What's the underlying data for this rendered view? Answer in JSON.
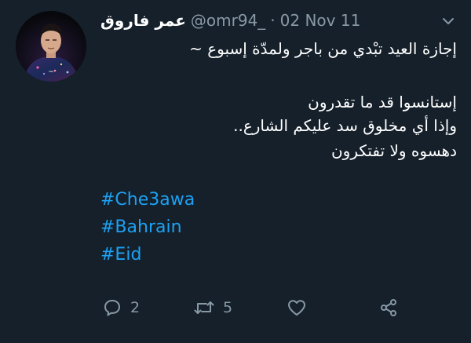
{
  "tweet": {
    "author_name": "عمر فاروق",
    "handle": "@omr94_",
    "separator": "·",
    "date": "02 Nov 11",
    "lines": [
      "إجازة العيد تبْدي من باجر ولمدّة إسبوع ~",
      "إستانسوا قد ما تقدرون",
      "وإذا أي مخلوق سد عليكم الشارع..",
      "دهسوه ولا تفتكرون"
    ],
    "hashtags": [
      "#Che3awa",
      "#Bahrain",
      "#Eid"
    ],
    "actions": {
      "reply_count": "2",
      "retweet_count": "5"
    },
    "icons": {
      "reply": "reply-icon",
      "retweet": "retweet-icon",
      "like": "heart-icon",
      "share": "share-icon",
      "more": "chevron-down-icon"
    },
    "colors": {
      "background": "#15202b",
      "hashtag": "#1da1f2",
      "secondary_text": "#8899a6"
    }
  }
}
